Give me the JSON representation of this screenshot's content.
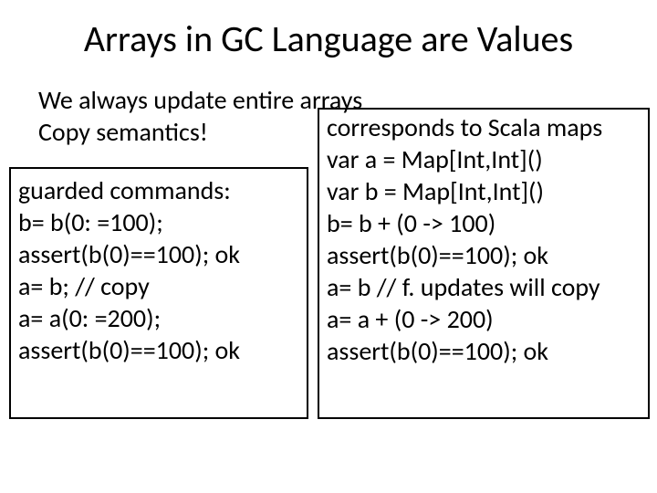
{
  "title": "Arrays in GC Language are Values",
  "intro": {
    "line1": "We always update entire arrays",
    "line2": "Copy semantics!"
  },
  "left": {
    "l1": "guarded commands:",
    "l2": "b= b(0: =100);",
    "l3": "assert(b(0)==100); ok",
    "l4": "a= b; // copy",
    "l5": "a= a(0: =200);",
    "l6": "assert(b(0)==100); ok"
  },
  "right": {
    "l1": "corresponds to Scala maps",
    "l2": "var a = Map[Int,Int]()",
    "l3": "var b = Map[Int,Int]()",
    "l4": "b= b + (0 -> 100)",
    "l5": "assert(b(0)==100); ok",
    "l6": "a= b // f. updates will copy",
    "l7": "a= a + (0 -> 200)",
    "l8": "assert(b(0)==100); ok"
  }
}
